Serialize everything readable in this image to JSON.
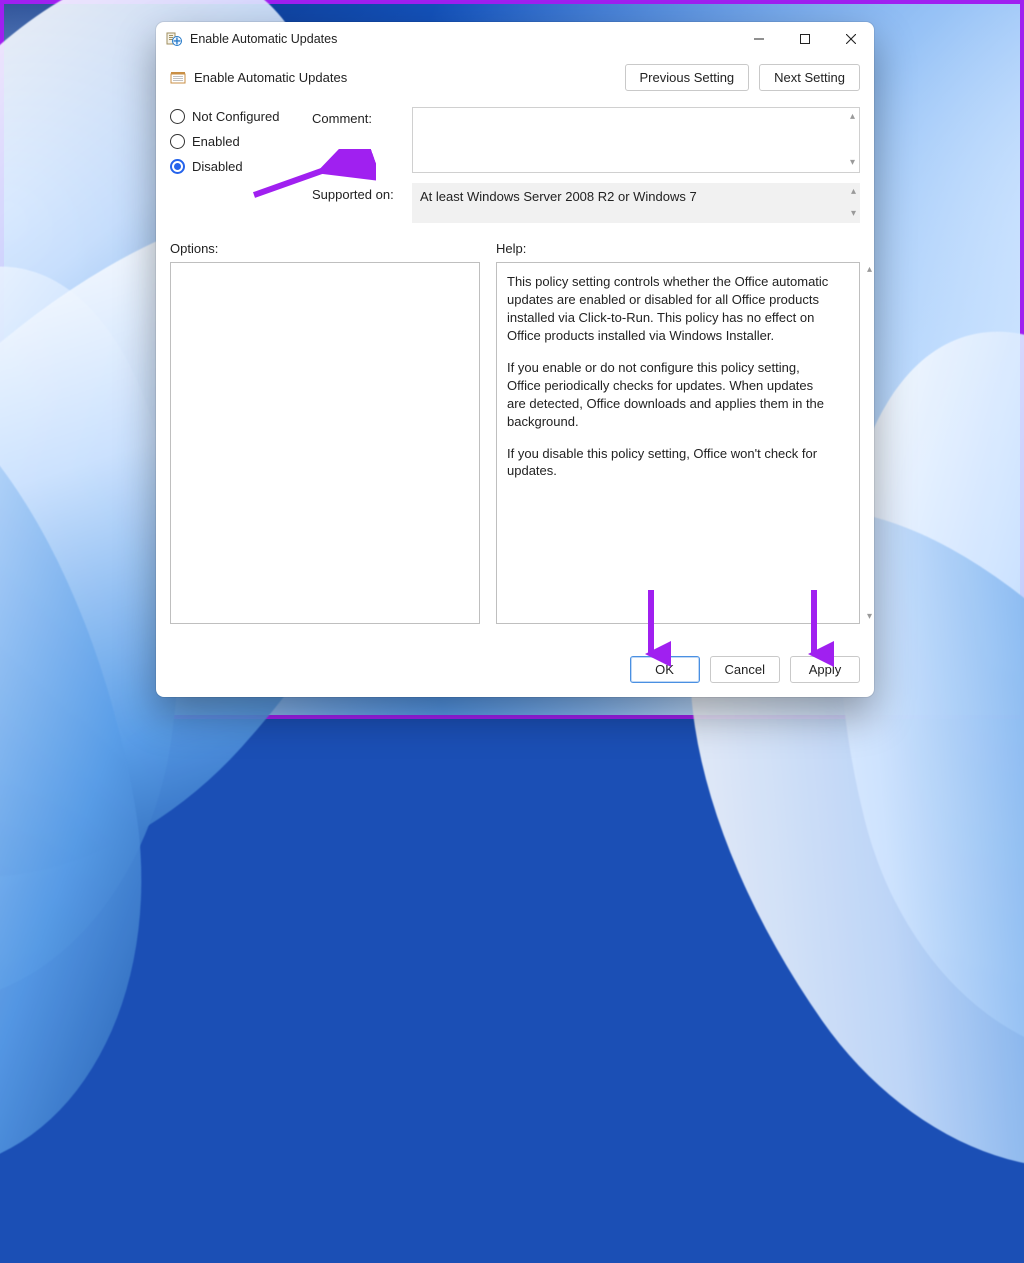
{
  "titlebar": {
    "title": "Enable Automatic Updates"
  },
  "toolbar": {
    "title": "Enable Automatic Updates",
    "previous_label": "Previous Setting",
    "next_label": "Next Setting"
  },
  "radios": {
    "not_configured": "Not Configured",
    "enabled": "Enabled",
    "disabled": "Disabled",
    "selected": "disabled"
  },
  "labels": {
    "comment": "Comment:",
    "supported": "Supported on:",
    "options": "Options:",
    "help": "Help:"
  },
  "supported_text": "At least Windows Server 2008 R2 or Windows 7",
  "help_paragraphs": [
    "This policy setting controls whether the Office automatic updates are enabled or disabled for all Office products installed via Click-to-Run. This policy has no effect on Office products installed via Windows Installer.",
    "If you enable or do not configure this policy setting, Office periodically checks for updates. When updates are detected, Office downloads and applies them in the background.",
    "If you disable this policy setting, Office won't check for updates."
  ],
  "footer": {
    "ok": "OK",
    "cancel": "Cancel",
    "apply": "Apply"
  },
  "annotation_color": "#a020f0"
}
